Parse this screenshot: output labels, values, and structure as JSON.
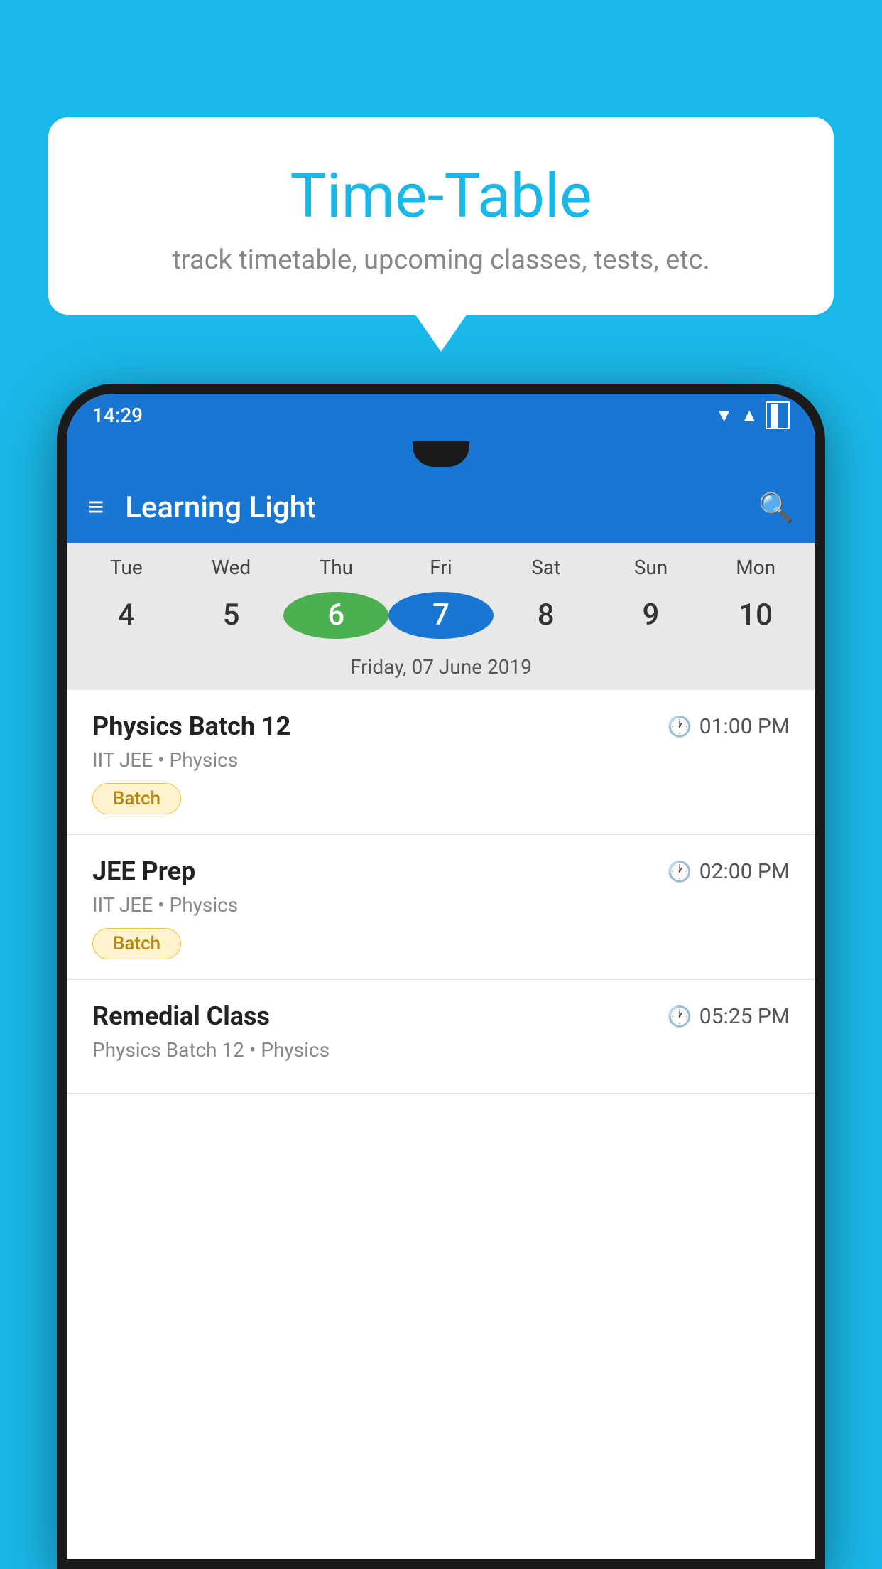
{
  "background_color": "#1ab8e8",
  "bubble": {
    "title": "Time-Table",
    "subtitle": "track timetable, upcoming classes, tests, etc."
  },
  "status_bar": {
    "time": "14:29",
    "wifi": "▼",
    "signal": "▲",
    "battery": "▌"
  },
  "app_bar": {
    "title": "Learning Light"
  },
  "calendar": {
    "days": [
      {
        "label": "Tue",
        "num": "4",
        "state": "normal"
      },
      {
        "label": "Wed",
        "num": "5",
        "state": "normal"
      },
      {
        "label": "Thu",
        "num": "6",
        "state": "today"
      },
      {
        "label": "Fri",
        "num": "7",
        "state": "selected"
      },
      {
        "label": "Sat",
        "num": "8",
        "state": "normal"
      },
      {
        "label": "Sun",
        "num": "9",
        "state": "normal"
      },
      {
        "label": "Mon",
        "num": "10",
        "state": "normal"
      }
    ],
    "selected_date_label": "Friday, 07 June 2019"
  },
  "schedule": [
    {
      "title": "Physics Batch 12",
      "time": "01:00 PM",
      "subtitle": "IIT JEE • Physics",
      "badge": "Batch"
    },
    {
      "title": "JEE Prep",
      "time": "02:00 PM",
      "subtitle": "IIT JEE • Physics",
      "badge": "Batch"
    },
    {
      "title": "Remedial Class",
      "time": "05:25 PM",
      "subtitle": "Physics Batch 12 • Physics",
      "badge": null
    }
  ],
  "icons": {
    "hamburger": "≡",
    "search": "🔍",
    "clock": "🕐"
  }
}
